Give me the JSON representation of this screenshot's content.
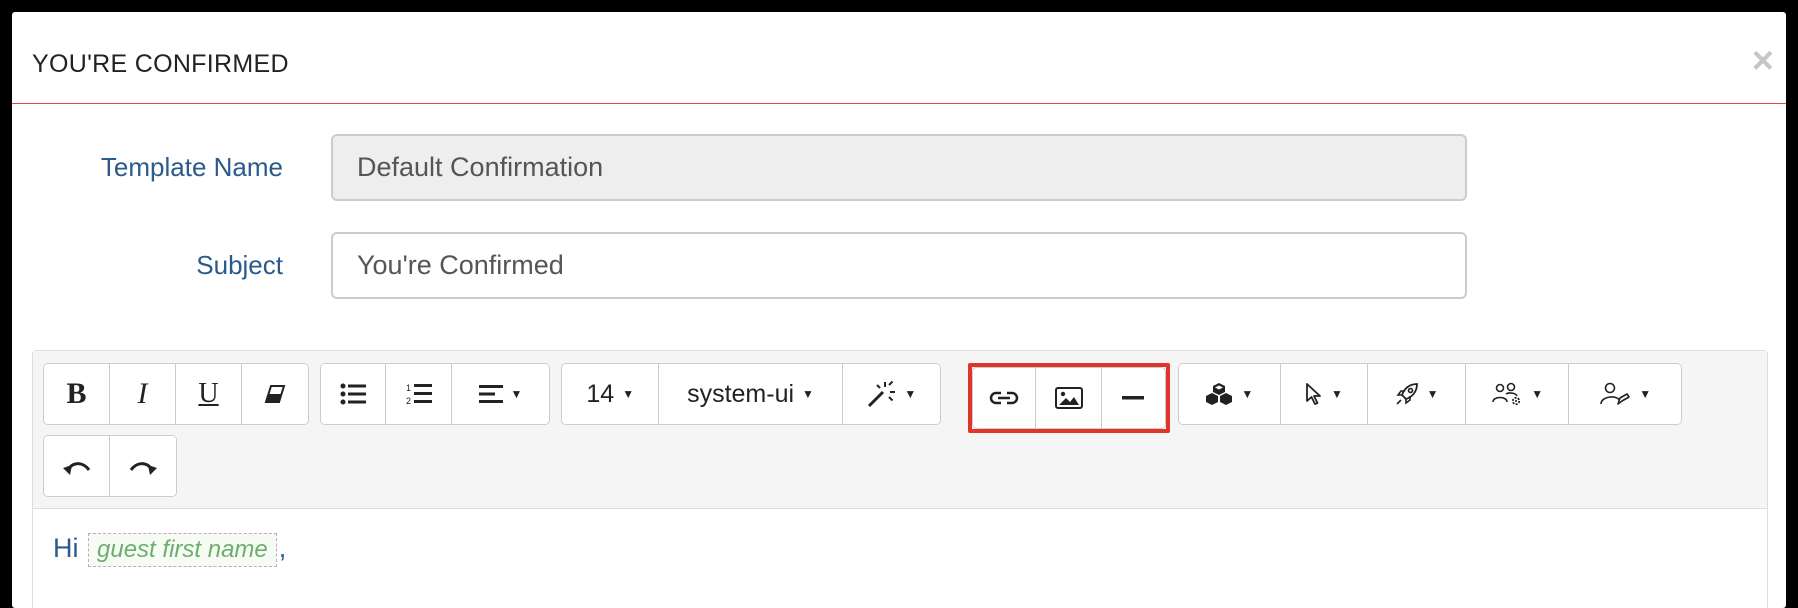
{
  "modal": {
    "title": "YOU'RE CONFIRMED",
    "close_glyph": "×"
  },
  "form": {
    "template_name": {
      "label": "Template Name",
      "value": "Default Confirmation"
    },
    "subject": {
      "label": "Subject",
      "value": "You're Confirmed"
    }
  },
  "toolbar": {
    "font_size": "14",
    "font_family": "system-ui",
    "buttons": [
      "bold-icon",
      "italic-icon",
      "underline-icon",
      "eraser-icon",
      "unordered-list-icon",
      "ordered-list-icon",
      "align-icon",
      "magic-wand-icon",
      "link-icon",
      "image-icon",
      "horizontal-rule-icon",
      "cubes-icon",
      "pointer-icon",
      "rocket-icon",
      "users-gear-icon",
      "user-pen-icon",
      "undo-icon",
      "redo-icon"
    ],
    "highlight_color": "#e0352b"
  },
  "editor": {
    "greeting": "Hi",
    "placeholder": "guest first name",
    "trailing": ","
  },
  "colors": {
    "label": "#2b5a8c",
    "header_border": "#e04a3b",
    "placeholder_text": "#6cae6c"
  }
}
